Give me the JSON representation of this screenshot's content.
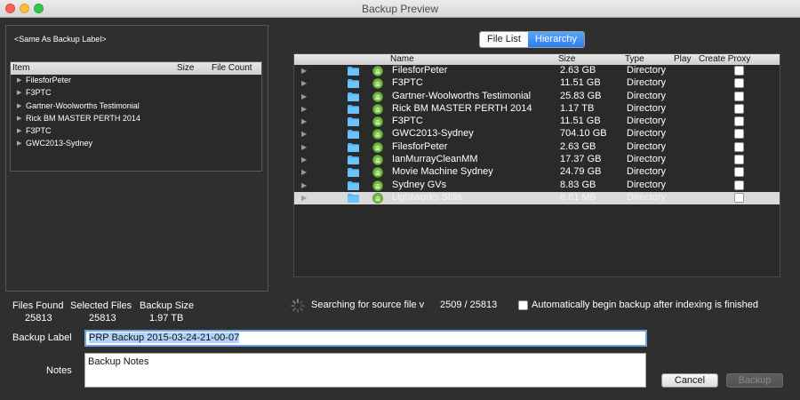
{
  "window": {
    "title": "Backup Preview"
  },
  "left_panel": {
    "label": "<Same As Backup Label>",
    "tree_columns": {
      "item": "Item",
      "size": "Size",
      "file_count": "File Count"
    },
    "tree_items": [
      "FilesforPeter",
      "F3PTC",
      "Gartner-Woolworths Testimonial",
      "Rick BM MASTER PERTH 2014",
      "F3PTC",
      "GWC2013-Sydney"
    ]
  },
  "view_tabs": {
    "file_list": "File List",
    "hierarchy": "Hierarchy",
    "selected": "Hierarchy"
  },
  "list": {
    "columns": {
      "name": "Name",
      "size": "Size",
      "type": "Type",
      "play": "Play",
      "create_proxy": "Create Proxy"
    },
    "rows": [
      {
        "name": "FilesforPeter",
        "size": "2.63 GB",
        "type": "Directory"
      },
      {
        "name": "F3PTC",
        "size": "11.51 GB",
        "type": "Directory"
      },
      {
        "name": "Gartner-Woolworths Testimonial",
        "size": "25.83 GB",
        "type": "Directory"
      },
      {
        "name": "Rick BM MASTER PERTH 2014",
        "size": "1.17 TB",
        "type": "Directory"
      },
      {
        "name": "F3PTC",
        "size": "11.51 GB",
        "type": "Directory"
      },
      {
        "name": "GWC2013-Sydney",
        "size": "704.10 GB",
        "type": "Directory"
      },
      {
        "name": "FilesforPeter",
        "size": "2.63 GB",
        "type": "Directory"
      },
      {
        "name": "IanMurrayCleanMM",
        "size": "17.37 GB",
        "type": "Directory"
      },
      {
        "name": "Movie Machine Sydney",
        "size": "24.79 GB",
        "type": "Directory"
      },
      {
        "name": "Sydney GVs",
        "size": "8.83 GB",
        "type": "Directory"
      },
      {
        "name": "Lightworks Stills",
        "size": "8.81 MB",
        "type": "Directory"
      }
    ]
  },
  "stats": {
    "files_found_label": "Files Found",
    "files_found": "25813",
    "selected_files_label": "Selected Files",
    "selected_files": "25813",
    "backup_size_label": "Backup Size",
    "backup_size": "1.97 TB"
  },
  "search": {
    "status": "Searching for source file v",
    "count": "2509  /  25813",
    "auto_begin_label": "Automatically begin backup after indexing is finished"
  },
  "form": {
    "backup_label_label": "Backup Label",
    "backup_label_value": "PRP Backup 2015-03-24-21-00-07",
    "notes_label": "Notes",
    "notes_value": "Backup Notes"
  },
  "buttons": {
    "cancel": "Cancel",
    "backup": "Backup"
  }
}
